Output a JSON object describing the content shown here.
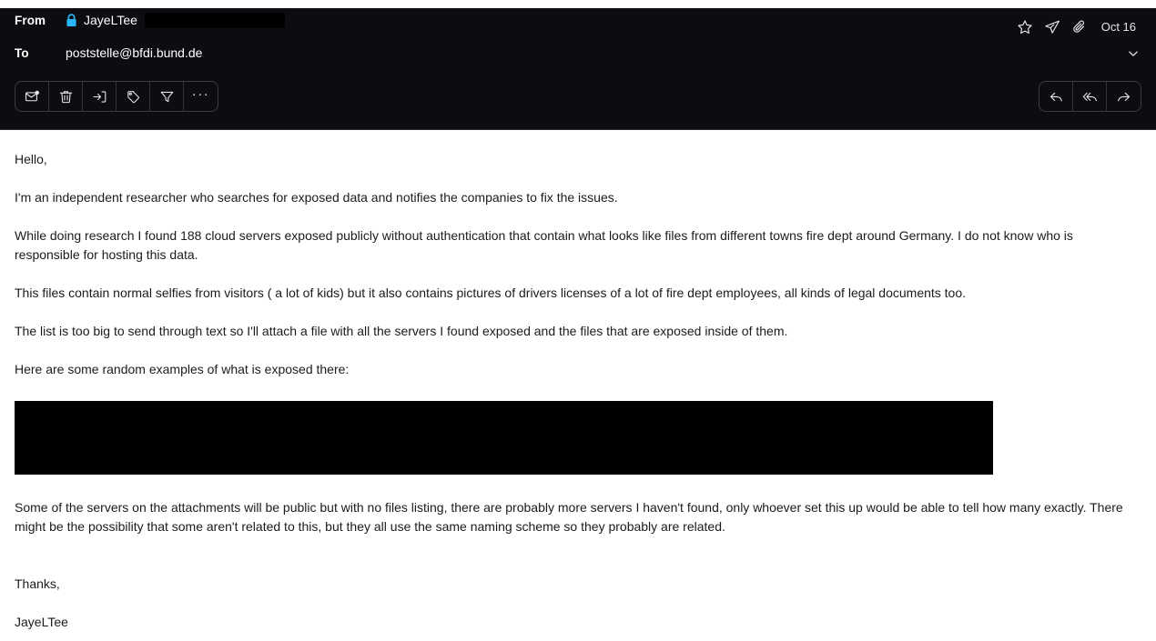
{
  "header": {
    "from_label": "From",
    "to_label": "To",
    "from_name": "JayeLTee",
    "from_redacted": true,
    "to_value": "poststelle@bfdi.bund.de",
    "date": "Oct 16",
    "icons": {
      "lock": "lock-icon",
      "star": "star-icon",
      "send": "paper-plane-icon",
      "attachment": "paperclip-icon",
      "expand": "chevron-down-icon"
    },
    "colors": {
      "background": "#0c0c11",
      "lock_accent": "#29b6f6",
      "text": "#ffffff",
      "redaction": "#000000"
    }
  },
  "toolbar": {
    "left_buttons": [
      {
        "name": "mark-unread-button",
        "icon": "envelope-dot-icon",
        "label": "Mark as unread"
      },
      {
        "name": "delete-button",
        "icon": "trash-icon",
        "label": "Delete"
      },
      {
        "name": "archive-button",
        "icon": "archive-in-icon",
        "label": "Archive"
      },
      {
        "name": "tag-button",
        "icon": "tag-icon",
        "label": "Tag"
      },
      {
        "name": "filter-button",
        "icon": "funnel-icon",
        "label": "Filter"
      },
      {
        "name": "more-options-button",
        "icon": "ellipsis-icon",
        "label": "More"
      }
    ],
    "more_glyph": "···",
    "right_buttons": [
      {
        "name": "reply-button",
        "icon": "reply-arrow-icon",
        "label": "Reply"
      },
      {
        "name": "reply-all-button",
        "icon": "reply-all-arrow-icon",
        "label": "Reply all"
      },
      {
        "name": "forward-button",
        "icon": "forward-arrow-icon",
        "label": "Forward"
      }
    ]
  },
  "body": {
    "greeting": "Hello,",
    "paragraph_1": "I'm an independent researcher who searches for exposed data and notifies the companies to fix the issues.",
    "paragraph_2": "While doing research I found 188 cloud servers exposed publicly without authentication that contain what looks like files from different towns fire dept around Germany. I do not know who is responsible for hosting this data.",
    "paragraph_3": "This files contain normal selfies from visitors ( a lot of kids) but it also contains pictures of drivers licenses of a lot of fire dept employees, all kinds of legal documents too.",
    "paragraph_4": "The list is too big to send through text so I'll attach a file with all the servers I found exposed and the files that are exposed inside of them.",
    "paragraph_5": "Here are some random examples of what is exposed there:",
    "redacted_image_note": "",
    "paragraph_6": "Some of the servers on the attachments will be public but with no files listing, there are probably more servers I haven't found, only whoever set this up would be able to tell how many exactly. There might be the possibility that some aren't related to this, but they all use the same naming scheme so they probably are related.",
    "closing": "Thanks,",
    "signature": "JayeLTee"
  }
}
